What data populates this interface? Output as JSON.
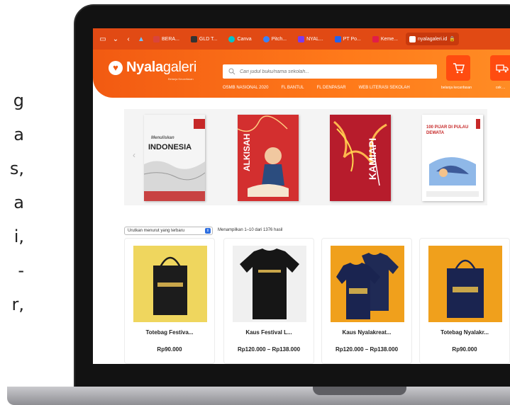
{
  "side_text": [
    "g",
    "a",
    "s,",
    "a",
    "i,",
    "-",
    "r,"
  ],
  "browser": {
    "tabs": [
      {
        "label": "BERA...",
        "color": "#d9443c"
      },
      {
        "label": "GLD T...",
        "color": "#333333"
      },
      {
        "label": "Canva",
        "color": "#00c4cc"
      },
      {
        "label": "Pitch...",
        "color": "#3b82f6"
      },
      {
        "label": "NYAL...",
        "color": "#7c3aed"
      },
      {
        "label": "PT Po...",
        "color": "#2563eb"
      },
      {
        "label": "Keme...",
        "color": "#e11d48"
      },
      {
        "label": "nyalagaleri.id",
        "color": "#ffffff",
        "active": true
      }
    ]
  },
  "header": {
    "logo_bold": "Nyala",
    "logo_light": "galeri",
    "tagline": "Belanja Kecanfasan",
    "search_placeholder": "Cari judul buku/nama sekolah...",
    "nav": [
      "OSMB NASIONAL 2020",
      "FL BANTUL",
      "FL DENPASAR",
      "WEB LITERASI SEKOLAH"
    ],
    "cart_label": "belanja kecanfasan",
    "cart2_label": "cek ...",
    "accent": "#f25a12"
  },
  "books": [
    {
      "title": "INDONESIA",
      "subtitle": "Menuliskan",
      "bg": "#ffffff"
    },
    {
      "title": "ALKISAH",
      "bg": "#c62828"
    },
    {
      "title": "KAMIAPI",
      "bg": "#b71c2c"
    },
    {
      "title": "100 PIJAR DI PULAU DEWATA",
      "bg": "#ffffff"
    }
  ],
  "listing": {
    "sort_label": "Urutkan menurut yang terbaru",
    "results_text": "Menampilkan 1–10 dari 1376 hasil"
  },
  "products": [
    {
      "name": "Totebag Festiva...",
      "price": "Rp90.000"
    },
    {
      "name": "Kaus Festival L...",
      "price": "Rp120.000 – Rp138.000"
    },
    {
      "name": "Kaus Nyalakreat...",
      "price": "Rp120.000 – Rp138.000"
    },
    {
      "name": "Totebag Nyalakr...",
      "price": "Rp90.000"
    }
  ]
}
